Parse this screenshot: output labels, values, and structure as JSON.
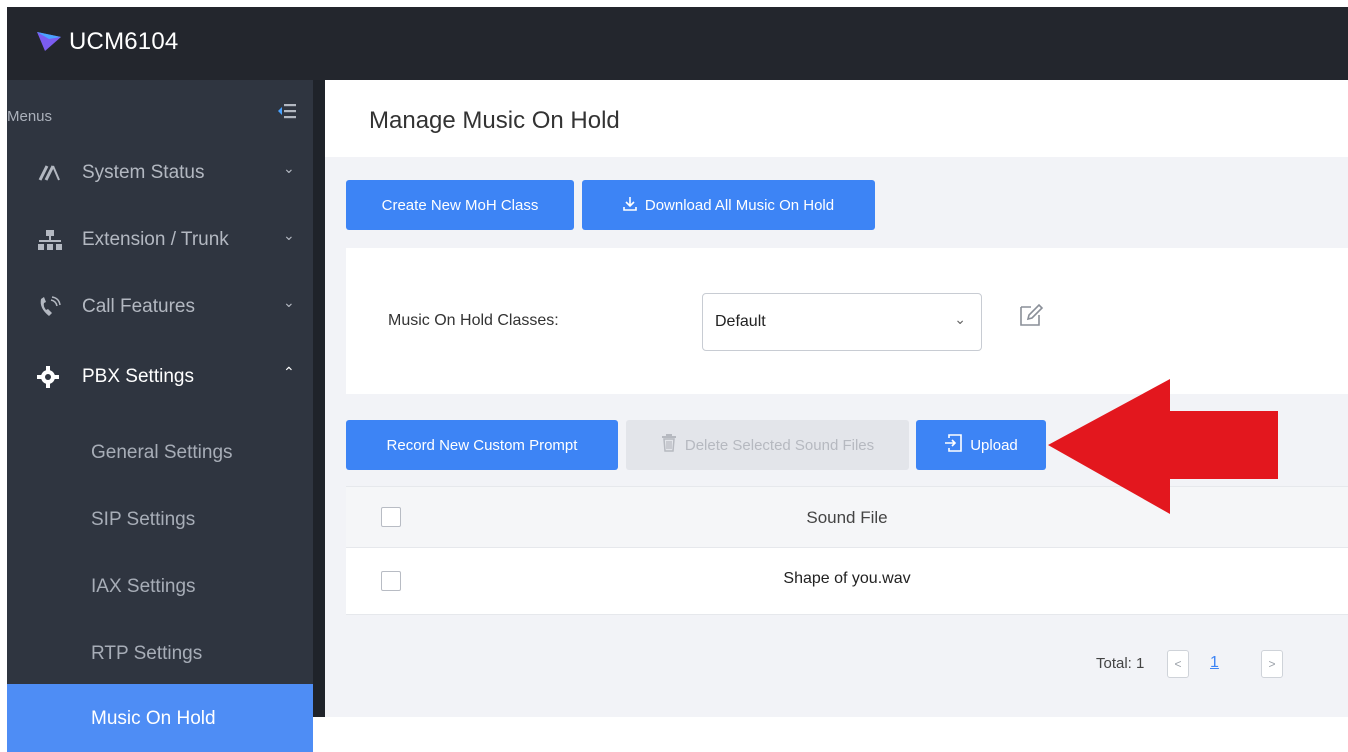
{
  "app": {
    "title": "UCM6104"
  },
  "sidebar": {
    "menus_label": "Menus",
    "items": [
      {
        "label": "System Status",
        "icon": "gauge-icon"
      },
      {
        "label": "Extension / Trunk",
        "icon": "network-icon"
      },
      {
        "label": "Call Features",
        "icon": "phone-icon"
      },
      {
        "label": "PBX Settings",
        "icon": "gear-icon",
        "expanded": true
      }
    ],
    "sub_items": [
      {
        "label": "General Settings"
      },
      {
        "label": "SIP Settings"
      },
      {
        "label": "IAX Settings"
      },
      {
        "label": "RTP Settings"
      },
      {
        "label": "Music On Hold",
        "selected": true
      }
    ]
  },
  "page": {
    "title": "Manage Music On Hold",
    "toolbar": {
      "create_label": "Create New MoH Class",
      "download_label": "Download All Music On Hold"
    },
    "moh": {
      "label": "Music On Hold Classes:",
      "selected": "Default"
    },
    "actions": {
      "record_label": "Record New Custom Prompt",
      "delete_label": "Delete Selected Sound Files",
      "upload_label": "Upload"
    },
    "table": {
      "header": "Sound File",
      "rows": [
        {
          "file": "Shape of you.wav"
        }
      ]
    },
    "pagination": {
      "total_label": "Total: 1",
      "page": "1"
    }
  },
  "colors": {
    "primary": "#3d84f5",
    "sidebar": "#2f3540",
    "topbar": "#23262d",
    "annotation_arrow": "#e3171e"
  }
}
